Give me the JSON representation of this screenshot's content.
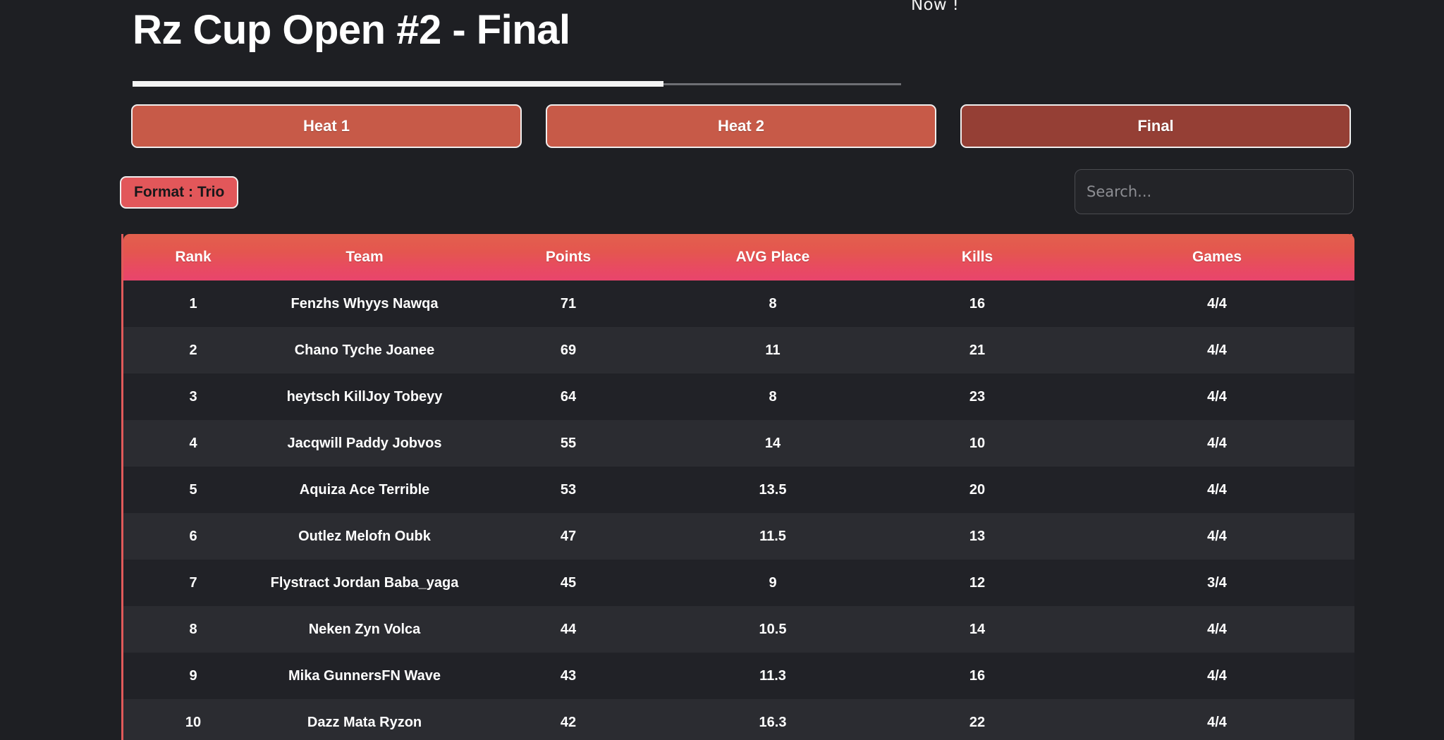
{
  "banner": {
    "text": "Now !"
  },
  "header": {
    "title": "Rz Cup Open #2 - Final"
  },
  "tabs": [
    {
      "label": "Heat 1",
      "active": false
    },
    {
      "label": "Heat 2",
      "active": false
    },
    {
      "label": "Final",
      "active": true
    }
  ],
  "controls": {
    "format_badge": "Format : Trio",
    "search_placeholder": "Search...",
    "search_value": ""
  },
  "colors": {
    "page_background": "#1e1f23",
    "tab_inactive": "#c75a48",
    "tab_active": "#953f35",
    "format_badge": "#e2575a",
    "table_border": "#e05a5a",
    "header_gradient_top": "#e2604d",
    "header_gradient_bottom": "#e8456c",
    "row_odd": "#212227",
    "row_even": "#2b2c31"
  },
  "table": {
    "columns": [
      "Rank",
      "Team",
      "Points",
      "AVG Place",
      "Kills",
      "Games"
    ],
    "rows": [
      {
        "rank": "1",
        "team": "Fenzhs Whyys Nawqa",
        "points": "71",
        "avg_place": "8",
        "kills": "16",
        "games": "4/4"
      },
      {
        "rank": "2",
        "team": "Chano Tyche Joanee",
        "points": "69",
        "avg_place": "11",
        "kills": "21",
        "games": "4/4"
      },
      {
        "rank": "3",
        "team": "heytsch KillJoy Tobeyy",
        "points": "64",
        "avg_place": "8",
        "kills": "23",
        "games": "4/4"
      },
      {
        "rank": "4",
        "team": "Jacqwill Paddy Jobvos",
        "points": "55",
        "avg_place": "14",
        "kills": "10",
        "games": "4/4"
      },
      {
        "rank": "5",
        "team": "Aquiza Ace Terrible",
        "points": "53",
        "avg_place": "13.5",
        "kills": "20",
        "games": "4/4"
      },
      {
        "rank": "6",
        "team": "Outlez Melofn Oubk",
        "points": "47",
        "avg_place": "11.5",
        "kills": "13",
        "games": "4/4"
      },
      {
        "rank": "7",
        "team": "Flystract Jordan Baba_yaga",
        "points": "45",
        "avg_place": "9",
        "kills": "12",
        "games": "3/4"
      },
      {
        "rank": "8",
        "team": "Neken Zyn Volca",
        "points": "44",
        "avg_place": "10.5",
        "kills": "14",
        "games": "4/4"
      },
      {
        "rank": "9",
        "team": "Mika GunnersFN Wave",
        "points": "43",
        "avg_place": "11.3",
        "kills": "16",
        "games": "4/4"
      },
      {
        "rank": "10",
        "team": "Dazz Mata Ryzon",
        "points": "42",
        "avg_place": "16.3",
        "kills": "22",
        "games": "4/4"
      }
    ]
  }
}
